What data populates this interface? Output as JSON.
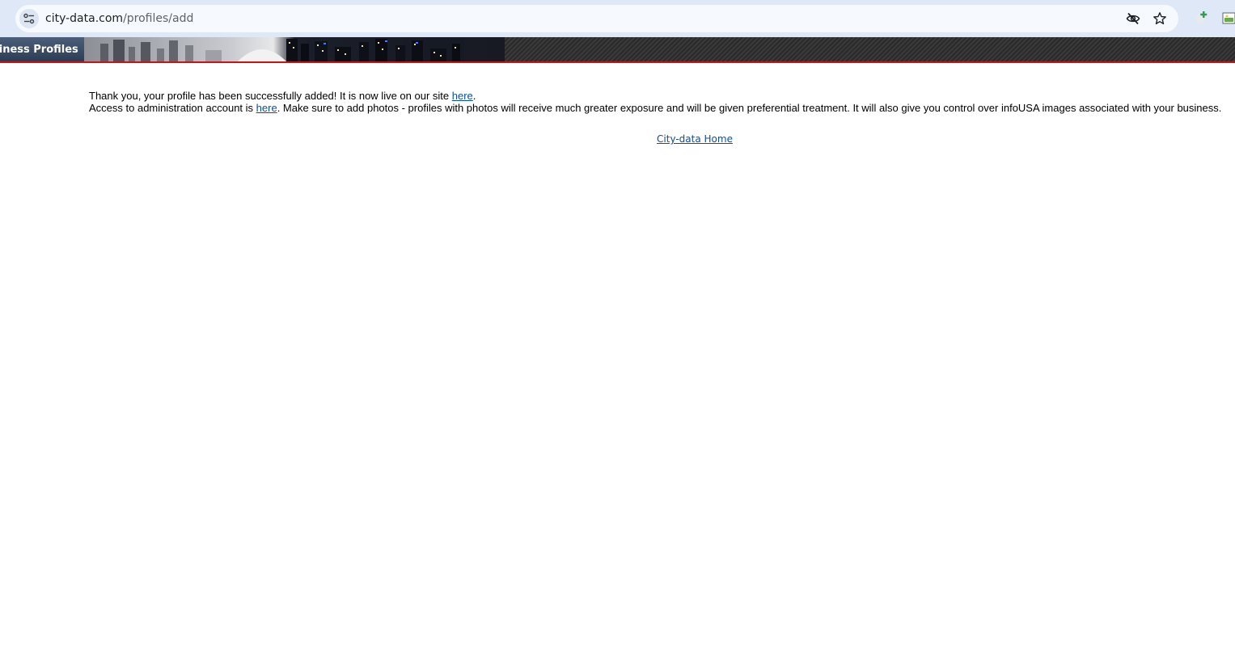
{
  "browser": {
    "url_host": "city-data.com",
    "url_path": "/profiles/add"
  },
  "header": {
    "title": "siness Profiles"
  },
  "content": {
    "line1_text": "Thank you, your profile has been successfully added! It is now live on our site ",
    "line1_link": "here",
    "line1_end": ".",
    "line2_text": "Access to administration account is ",
    "line2_link": "here",
    "line2_end": ". Make sure to add photos - profiles with photos will receive much greater exposure and will be given preferential treatment. It will also give you control over infoUSA images associated with your business.",
    "home_link": "City-data Home"
  },
  "colors": {
    "link": "#0b4ea2",
    "banner_border": "#c81414"
  }
}
